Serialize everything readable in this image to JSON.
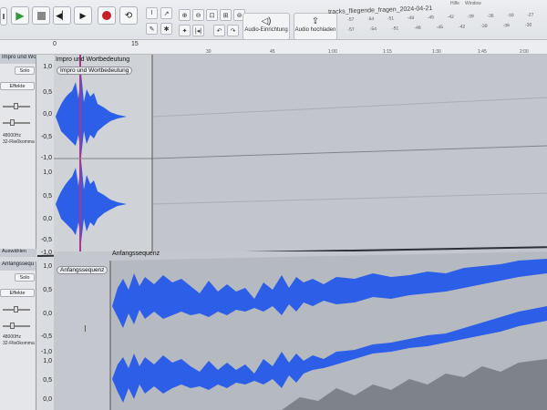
{
  "window": {
    "title": "tracks_fliegende_fragen_2024-04-21",
    "menu_extra": [
      "Hilfe",
      "Window"
    ]
  },
  "toolbar": {
    "transport": [
      "pause-button",
      "play-button",
      "stop-button",
      "skip-start-button",
      "skip-end-button",
      "record-button",
      "loop-button"
    ],
    "audio_setup_label": "Audio-Einrichtung",
    "audio_share_label": "Audio hochladen",
    "meter_ticks": [
      "-57",
      "-54",
      "-51",
      "-48",
      "-45",
      "-42",
      "-39",
      "-36",
      "-30",
      "-27"
    ],
    "meter_ticks_row2": [
      "-57",
      "-54",
      "-51",
      "-48",
      "-45",
      "-42",
      "-39",
      "-36",
      "-30"
    ]
  },
  "ruler": {
    "labels": [
      "0",
      "15",
      "30",
      "45",
      "1:00",
      "1:15",
      "1:30",
      "1:45",
      "2:00"
    ],
    "top_left_labels": [
      "15",
      "30"
    ]
  },
  "tracks": [
    {
      "name": "Impro und Wor",
      "solo_label": "Solo",
      "effects_label": "Effekte",
      "rate_label": "48000Hz",
      "format_label": "32-Fließkomma",
      "select_label": "Auswählen",
      "clip_title": "Impro und Wortbedeutung",
      "clip_pill": "Impro und Wortbedeutung",
      "scale_top": [
        "1,0",
        "0,5",
        "0,0",
        "-0,5",
        "-1,0"
      ],
      "scale_bottom": [
        "1,0",
        "0,5",
        "0,0",
        "-0,5",
        "-1,0"
      ]
    },
    {
      "name": "Anfangssequ",
      "solo_label": "Solo",
      "effects_label": "Effekte",
      "rate_label": "48000Hz",
      "format_label": "32-Fließkomma",
      "clip_title": "Anfangssequenz",
      "clip_pill": "Anfangssequenz",
      "scale": [
        "1,0",
        "0,5",
        "0,0",
        "-0,5",
        "-1,0",
        "1,0",
        "0,5",
        "0,0"
      ]
    }
  ],
  "colors": {
    "waveform": "#2d5ee8",
    "waveform_dark": "#1e3fc0",
    "playhead": "#b0348c",
    "third_track_wave": "#7e838b"
  }
}
